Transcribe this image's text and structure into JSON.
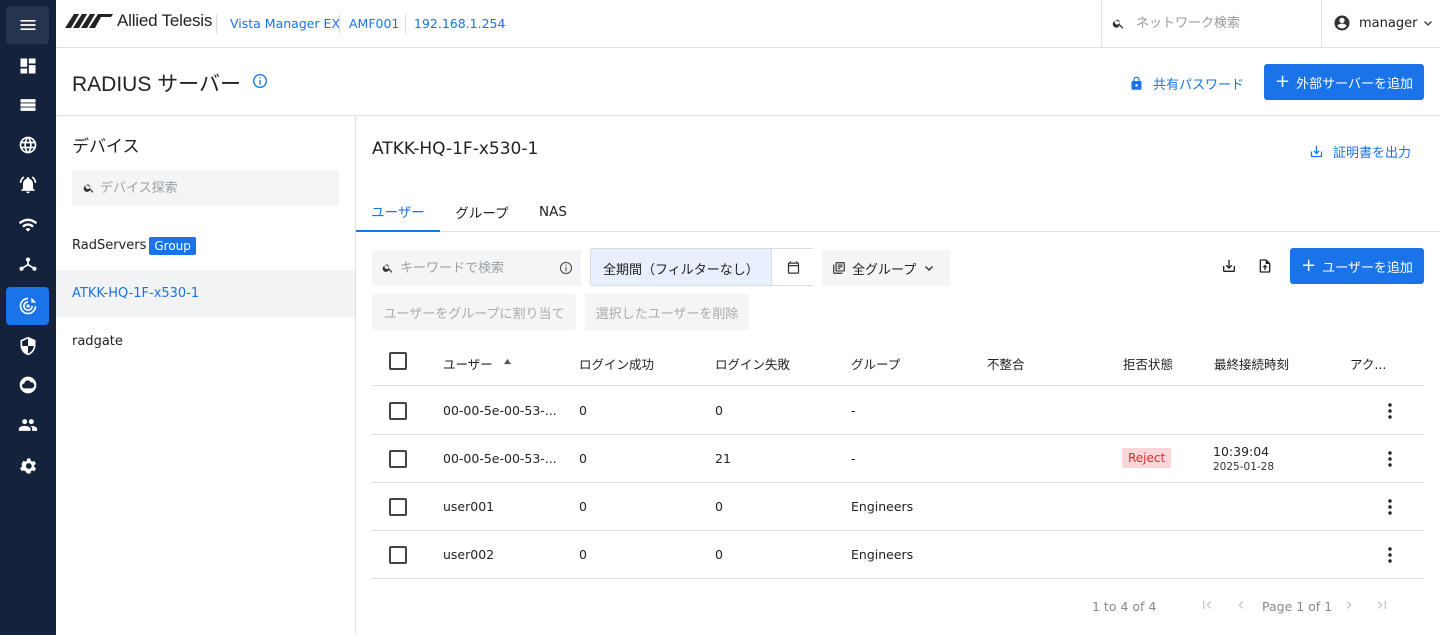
{
  "header": {
    "brand": "Allied Telesis",
    "breadcrumbs": [
      "Vista Manager EX",
      "AMF001",
      "192.168.1.254"
    ],
    "search_placeholder": "ネットワーク検索",
    "username": "manager"
  },
  "sidebar_icons": [
    "menu-icon",
    "dashboard-icon",
    "list-icon",
    "globe-icon",
    "alarm-icon",
    "wifi-icon",
    "network-icon",
    "radius-icon",
    "shield-icon",
    "cloud-icon",
    "users-icon",
    "gear-icon"
  ],
  "page": {
    "title": "RADIUS サーバー",
    "shared_password_label": "共有パスワード",
    "add_external_server_label": "外部サーバーを追加"
  },
  "devices": {
    "title": "デバイス",
    "search_placeholder": "デバイス探索",
    "items": [
      {
        "name": "RadServers",
        "badge": "Group"
      },
      {
        "name": "ATKK-HQ-1F-x530-1",
        "badge": ""
      },
      {
        "name": "radgate",
        "badge": ""
      }
    ],
    "selected_index": 1
  },
  "detail": {
    "device_name": "ATKK-HQ-1F-x530-1",
    "export_cert_label": "証明書を出力",
    "tabs": [
      "ユーザー",
      "グループ",
      "NAS"
    ],
    "active_tab": 0,
    "keyword_placeholder": "キーワードで検索",
    "period_label": "全期間（フィルターなし）",
    "group_filter_label": "全グループ",
    "add_user_label": "ユーザーを追加",
    "assign_group_label": "ユーザーをグループに割り当て",
    "delete_selected_label": "選択したユーザーを削除"
  },
  "table": {
    "columns": [
      "ユーザー",
      "ログイン成功",
      "ログイン失敗",
      "グループ",
      "不整合",
      "拒否状態",
      "最終接続時刻",
      "アク..."
    ],
    "sort_column": "ユーザー",
    "sort_direction": "ascending",
    "rows": [
      {
        "user": "00-00-5e-00-53-...",
        "success": "0",
        "failed": "0",
        "group": "-",
        "mismatch": "",
        "reject": "",
        "time": "",
        "date": ""
      },
      {
        "user": "00-00-5e-00-53-...",
        "success": "0",
        "failed": "21",
        "group": "-",
        "mismatch": "",
        "reject": "Reject",
        "time": "10:39:04",
        "date": "2025-01-28"
      },
      {
        "user": "user001",
        "success": "0",
        "failed": "0",
        "group": "Engineers",
        "mismatch": "",
        "reject": "",
        "time": "",
        "date": ""
      },
      {
        "user": "user002",
        "success": "0",
        "failed": "0",
        "group": "Engineers",
        "mismatch": "",
        "reject": "",
        "time": "",
        "date": ""
      }
    ]
  },
  "pagination": {
    "range_text": "1 to 4 of 4",
    "page_text": "Page 1 of 1"
  },
  "colors": {
    "accent": "#1a73e8",
    "sidebar_bg": "#14223b",
    "reject_bg": "#fbd5d8",
    "reject_fg": "#d32f2f"
  }
}
